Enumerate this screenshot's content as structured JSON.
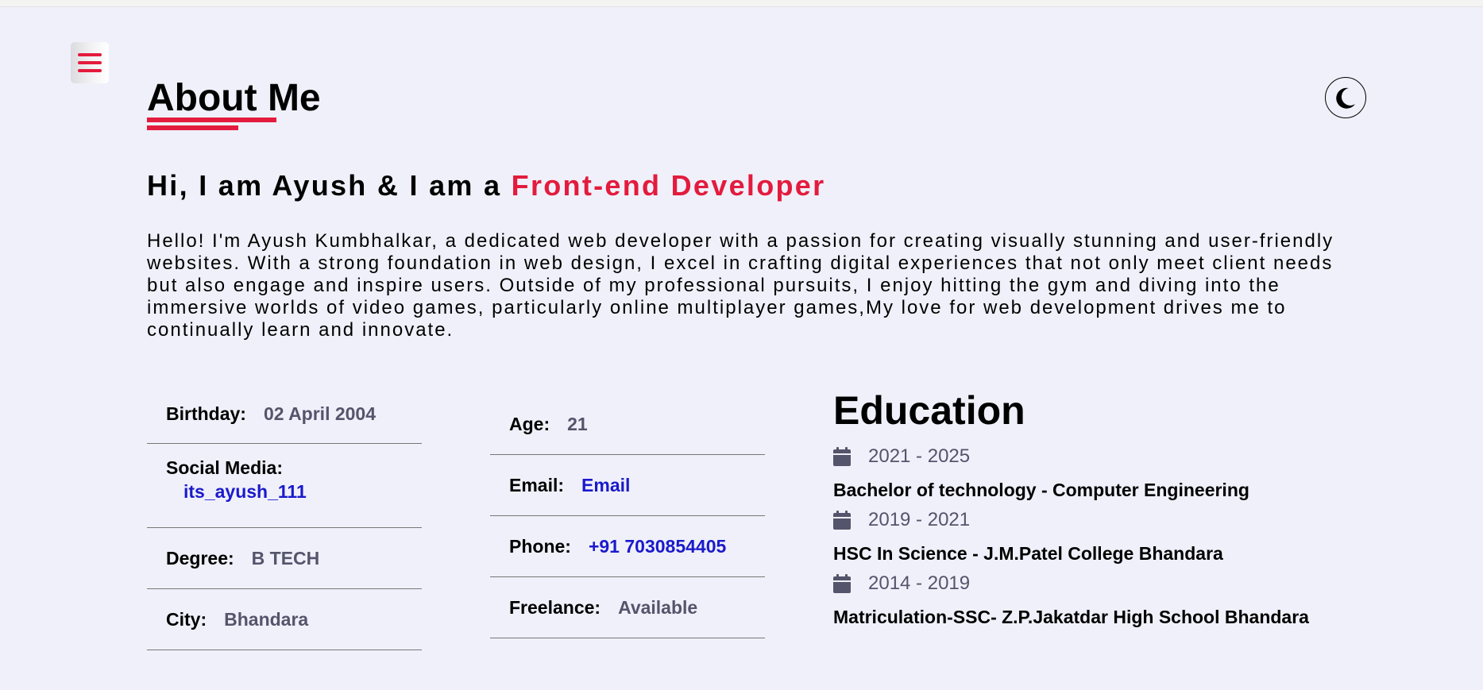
{
  "header": {
    "title": "About Me"
  },
  "icons": {
    "menu": "hamburger-menu-icon",
    "theme": "moon-icon",
    "calendar": "calendar-icon"
  },
  "colors": {
    "accent": "#e31b3d",
    "link": "#1a1acc",
    "muted": "#54546c",
    "background": "#f0f0fa"
  },
  "intro": {
    "prefix": "Hi, I am Ayush & I am a",
    "role": "Front-end Developer"
  },
  "bio": "Hello! I'm Ayush Kumbhalkar, a dedicated web developer with a passion for creating visually stunning and user-friendly websites. With a strong foundation in web design, I excel in crafting digital experiences that not only meet client needs but also engage and inspire users. Outside of my professional pursuits, I enjoy hitting the gym and diving into the immersive worlds of video games, particularly online multiplayer games,My love for web development drives me to continually learn and innovate.",
  "info_left": {
    "birthday": {
      "label": "Birthday:",
      "value": "02 April 2004"
    },
    "social": {
      "label": "Social Media:",
      "value": "its_ayush_111"
    },
    "degree": {
      "label": "Degree:",
      "value": "B TECH"
    },
    "city": {
      "label": "City:",
      "value": "Bhandara"
    }
  },
  "info_right": {
    "age": {
      "label": "Age:",
      "value": "21"
    },
    "email": {
      "label": "Email:",
      "value": "Email"
    },
    "phone": {
      "label": "Phone:",
      "value": "+91 7030854405"
    },
    "freelance": {
      "label": "Freelance:",
      "value": "Available"
    }
  },
  "education": {
    "title": "Education",
    "items": [
      {
        "years": "2021 - 2025",
        "degree": "Bachelor of technology - Computer Engineering"
      },
      {
        "years": "2019 - 2021",
        "degree": "HSC In Science - J.M.Patel College Bhandara"
      },
      {
        "years": "2014 - 2019",
        "degree": "Matriculation-SSC- Z.P.Jakatdar High School Bhandara"
      }
    ]
  }
}
